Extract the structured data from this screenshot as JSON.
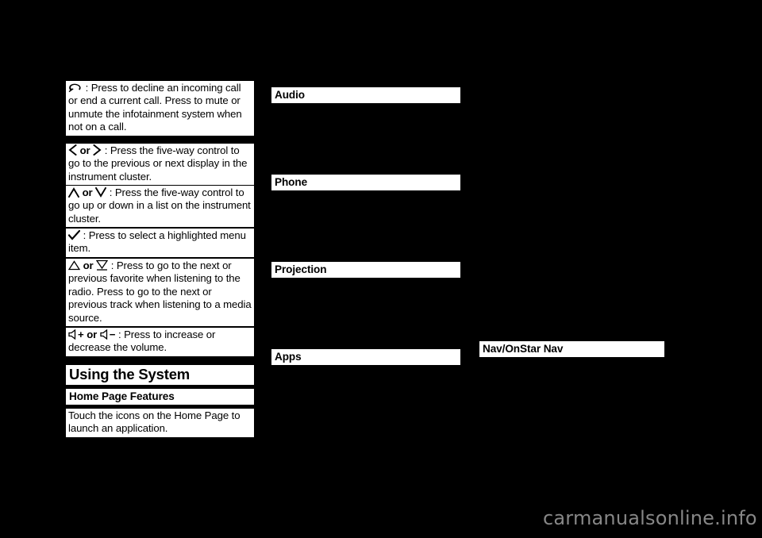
{
  "page": {
    "background_color": "#000000",
    "panel_color": "#ffffff",
    "text_color": "#000000",
    "watermark": "carmanualsonline.info",
    "watermark_color": "#878787"
  },
  "column_left": {
    "entries": [
      {
        "id": "decline-call",
        "icon": "phone-decline-icon",
        "prefix": " : ",
        "text": "Press to decline an incoming call or end a current call. Press to mute or unmute the infotainment system when not on a call."
      },
      {
        "id": "five-way-left-right",
        "icon_left": "chevron-left-icon",
        "conjunction": "or",
        "icon_right": "chevron-right-icon",
        "prefix": " : ",
        "text": "Press the five-way control to go to the previous or next display in the instrument cluster."
      },
      {
        "id": "five-way-up-down",
        "icon_left": "chevron-up-icon",
        "conjunction": "or",
        "icon_right": "chevron-down-icon",
        "prefix": " : ",
        "text": "Press the five-way control to go up or down in a list on the instrument cluster."
      },
      {
        "id": "select-menu-item",
        "icon": "checkmark-icon",
        "prefix": " : ",
        "text": "Press to select a highlighted menu item."
      },
      {
        "id": "seek-favorite",
        "icon_left": "triangle-up-icon",
        "conjunction": "or",
        "icon_right": "triangle-down-underline-icon",
        "prefix": " : ",
        "text": "Press to go to the next or previous favorite when listening to the radio. Press to go to the next or previous track when listening to a media source."
      },
      {
        "id": "volume",
        "icon_left": "speaker-icon",
        "plus": "+",
        "conjunction": "or",
        "icon_right": "speaker-icon",
        "minus": "−",
        "prefix": " : ",
        "text": "Press to increase or decrease the volume."
      }
    ],
    "heading_using_the_system": "Using the System",
    "heading_home_page_features": "Home Page Features",
    "home_page_body": "Touch the icons on the Home Page to launch an application."
  },
  "column_middle": {
    "headings": [
      {
        "id": "audio",
        "label": "Audio"
      },
      {
        "id": "phone",
        "label": "Phone"
      },
      {
        "id": "projection",
        "label": "Projection"
      },
      {
        "id": "apps",
        "label": "Apps"
      }
    ]
  },
  "column_right": {
    "headings": [
      {
        "id": "nav-onstar-nav",
        "label": "Nav/OnStar Nav"
      }
    ]
  }
}
